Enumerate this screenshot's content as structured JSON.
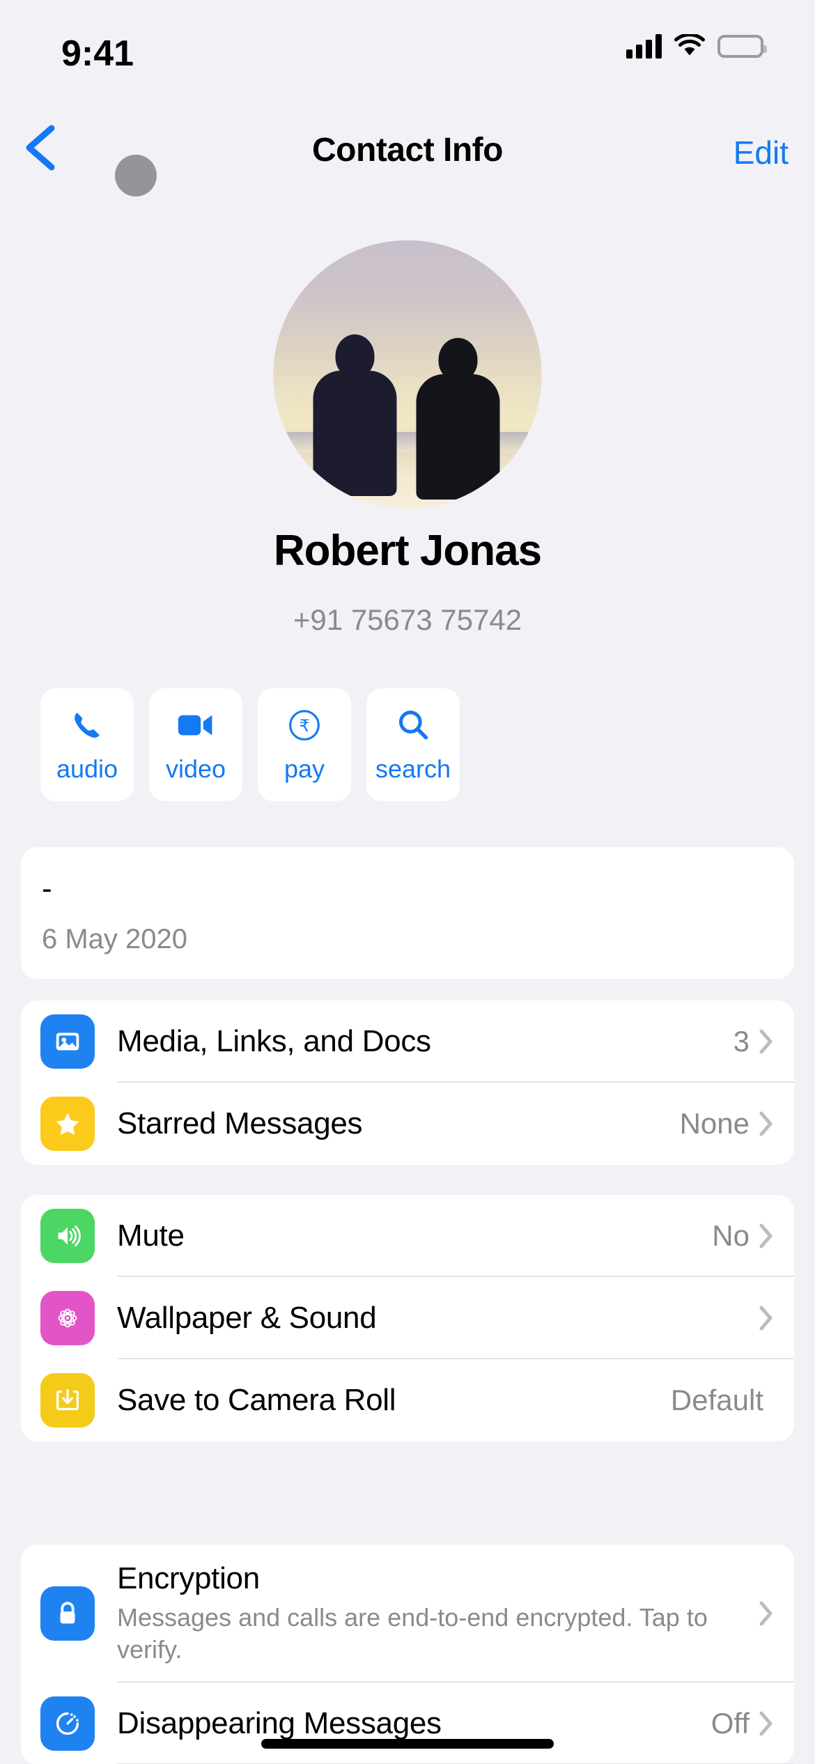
{
  "status_bar": {
    "time": "9:41",
    "signal_icon": "cellular-signal-icon",
    "wifi_icon": "wifi-icon",
    "battery_icon": "battery-icon"
  },
  "nav": {
    "back_icon": "chevron-left-icon",
    "title": "Contact Info",
    "edit_label": "Edit"
  },
  "profile": {
    "avatar_alt": "beach-sunset-two-people-photo",
    "name": "Robert Jonas",
    "phone": "+91 75673 75742"
  },
  "actions": [
    {
      "label": "audio",
      "icon": "phone-icon"
    },
    {
      "label": "video",
      "icon": "video-camera-icon"
    },
    {
      "label": "pay",
      "icon": "rupee-circle-icon"
    },
    {
      "label": "search",
      "icon": "search-icon"
    }
  ],
  "about": {
    "status": "-",
    "date": "6 May 2020"
  },
  "media_section": [
    {
      "label": "Media, Links, and Docs",
      "value": "3",
      "icon": "photo-icon",
      "icon_color": "#1E83F0",
      "chevron": true
    },
    {
      "label": "Starred Messages",
      "value": "None",
      "icon": "star-icon",
      "icon_color": "#FCCA1B",
      "chevron": true
    }
  ],
  "settings_section": [
    {
      "label": "Mute",
      "value": "No",
      "icon": "speaker-wave-icon",
      "icon_color": "#4CD663",
      "chevron": true
    },
    {
      "label": "Wallpaper & Sound",
      "value": "",
      "icon": "flower-icon",
      "icon_color": "#E255C8",
      "chevron": true
    },
    {
      "label": "Save to Camera Roll",
      "value": "Default",
      "icon": "download-box-icon",
      "icon_color": "#F5CB1A",
      "chevron": false
    }
  ],
  "privacy_section": {
    "encryption": {
      "label": "Encryption",
      "subtitle": "Messages and calls are end-to-end encrypted. Tap to verify.",
      "icon": "lock-icon",
      "icon_color": "#1E83F0"
    },
    "disappearing": {
      "label": "Disappearing Messages",
      "value": "Off",
      "icon": "timer-icon",
      "icon_color": "#1E83F0",
      "chevron": true
    }
  },
  "colors": {
    "accent_blue": "#1479F2",
    "page_background": "#F1F1F6",
    "card_background": "#FFFFFF",
    "secondary_text": "#8A8A8E"
  }
}
